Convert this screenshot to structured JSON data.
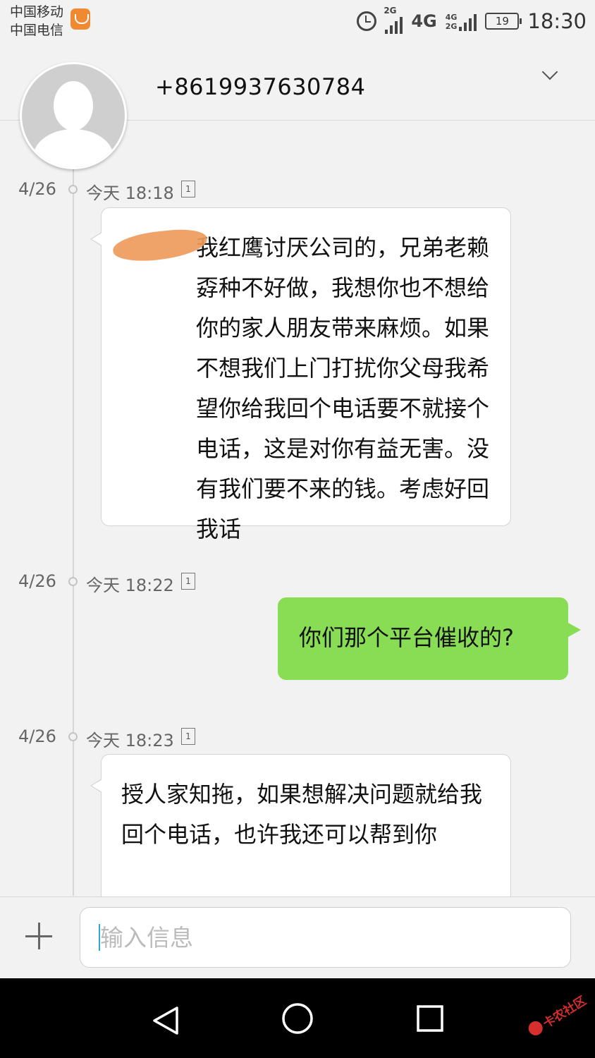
{
  "status_bar": {
    "carrier_1": "中国移动",
    "carrier_2": "中国电信",
    "signal_1_tag": "2G",
    "network_4g": "4G",
    "network_stack_top": "4G",
    "network_stack_bottom": "2G",
    "battery_level": "19",
    "time": "18:30",
    "icons": [
      "uc-browser-icon",
      "alarm-icon",
      "signal-icon",
      "signal-icon",
      "battery-icon"
    ]
  },
  "header": {
    "phone_number": "+8619937630784",
    "expand_icon": "chevron-down-icon"
  },
  "messages": [
    {
      "date": "4/26",
      "time": "今天 18:18",
      "sim": "1",
      "direction": "in",
      "text": "我红鹰讨厌公司的，兄弟老赖孬种不好做，我想你也不想给你的家人朋友带来麻烦。如果不想我们上门打扰你父母我希望你给我回个电话要不就接个电话，这是对你有益无害。没有我们要不来的钱。考虑好回我话"
    },
    {
      "date": "4/26",
      "time": "今天 18:22",
      "sim": "1",
      "direction": "out",
      "text": "你们那个平台催收的?"
    },
    {
      "date": "4/26",
      "time": "今天 18:23",
      "sim": "1",
      "direction": "in",
      "text": "授人家知拖，如果想解决问题就给我回个电话，也许我还可以帮到你"
    }
  ],
  "composer": {
    "placeholder": "输入信息",
    "add_icon": "plus-icon"
  },
  "nav_bar": {
    "icons": [
      "back-icon",
      "home-icon",
      "recent-apps-icon"
    ]
  },
  "watermark": {
    "text": "卡农社区"
  },
  "colors": {
    "background": "#f2f2f2",
    "outgoing_bubble": "#88dd55",
    "incoming_bubble": "#ffffff",
    "redaction": "#ef9b5c",
    "cursor": "#2aa8d8"
  }
}
